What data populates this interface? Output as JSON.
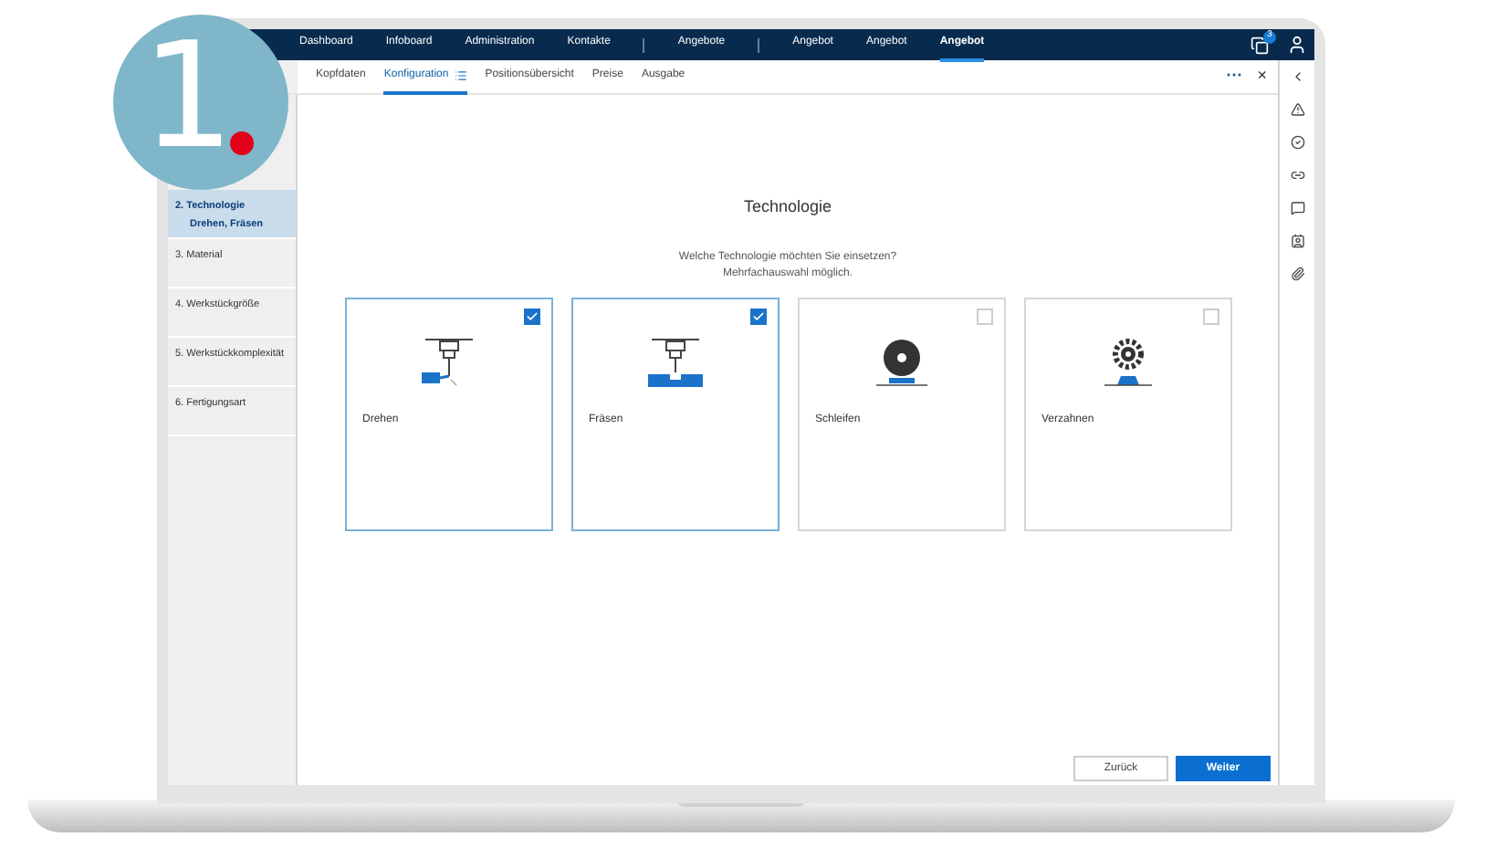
{
  "badge": {
    "number": "1"
  },
  "nav": {
    "items": [
      {
        "label": "Dashboard",
        "selected": false
      },
      {
        "label": "Infoboard",
        "selected": false
      },
      {
        "label": "Administration",
        "selected": false
      },
      {
        "label": "Kontakte",
        "selected": false,
        "divider_after": true
      },
      {
        "label": "Angebote",
        "selected": false,
        "divider_after": true
      },
      {
        "label": "Angebot",
        "selected": false
      },
      {
        "label": "Angebot",
        "selected": false
      },
      {
        "label": "Angebot",
        "selected": true
      }
    ],
    "notifications": "3"
  },
  "tabs": [
    {
      "label": "Kopfdaten",
      "selected": false
    },
    {
      "label": "Konfiguration",
      "selected": true
    },
    {
      "label": "Positionsübersicht",
      "selected": false
    },
    {
      "label": "Preise",
      "selected": false
    },
    {
      "label": "Ausgabe",
      "selected": false
    }
  ],
  "tab_actions": {
    "more": "···",
    "close": "×"
  },
  "sidebar": {
    "items": [
      {
        "number": "2.",
        "label": "Technologie",
        "value": "Drehen, Fräsen",
        "selected": true
      },
      {
        "number": "3.",
        "label": "Material",
        "selected": false
      },
      {
        "number": "4.",
        "label": "Werkstückgröße",
        "selected": false
      },
      {
        "number": "5.",
        "label": "Werkstückkomplexität",
        "selected": false
      },
      {
        "number": "6.",
        "label": "Fertigungsart",
        "selected": false
      }
    ]
  },
  "main": {
    "title": "Technologie",
    "question": "Welche Technologie möchten Sie einsetzen?",
    "hint": "Mehrfachauswahl möglich.",
    "options": [
      {
        "label": "Drehen",
        "kind": "turning",
        "checked": true
      },
      {
        "label": "Fräsen",
        "kind": "milling",
        "checked": true
      },
      {
        "label": "Schleifen",
        "kind": "grinding",
        "checked": false
      },
      {
        "label": "Verzahnen",
        "kind": "gearing",
        "checked": false
      }
    ]
  },
  "buttons": [
    {
      "label": "Zurück",
      "kind": "secondary"
    },
    {
      "label": "Weiter",
      "kind": "primary"
    }
  ]
}
